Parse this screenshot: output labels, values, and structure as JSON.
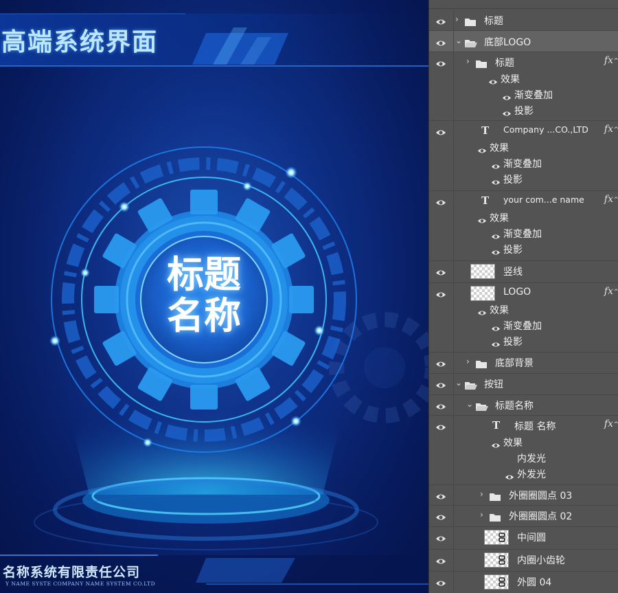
{
  "canvas": {
    "header_title": "高端系统界面",
    "gear_title_line1": "标题",
    "gear_title_line2": "名称",
    "company_name": "名称系统有限责任公司",
    "company_english": "Y NAME SYSTE COMPANY NAME SYSTEM CO.LTD"
  },
  "layers_panel": {
    "top_strip_text": "",
    "rows": [
      {
        "id": "r1",
        "type": "group",
        "label": "标题",
        "expanded": false,
        "fx": false
      },
      {
        "id": "r2",
        "type": "group",
        "label": "底部LOGO",
        "expanded": true,
        "fx": false,
        "selected": true
      },
      {
        "id": "r3",
        "type": "group",
        "label": "标题",
        "expanded": false,
        "fx": true,
        "effects_label": "效果",
        "effects": [
          "渐变叠加",
          "投影"
        ]
      },
      {
        "id": "r4",
        "type": "text",
        "label": "Company ...CO.,LTD",
        "fx": true,
        "effects_label": "效果",
        "effects": [
          "渐变叠加",
          "投影"
        ]
      },
      {
        "id": "r5",
        "type": "text",
        "label": "your com...e  name",
        "fx": true,
        "effects_label": "效果",
        "effects": [
          "渐变叠加",
          "投影"
        ]
      },
      {
        "id": "r6",
        "type": "pixel",
        "label": "竖线",
        "fx": false
      },
      {
        "id": "r7",
        "type": "pixel",
        "label": "LOGO",
        "fx": true,
        "effects_label": "效果",
        "effects": [
          "渐变叠加",
          "投影"
        ]
      },
      {
        "id": "r8",
        "type": "group",
        "label": "底部背景",
        "expanded": false,
        "fx": false
      },
      {
        "id": "r9",
        "type": "group",
        "label": "按钮",
        "expanded": true,
        "fx": false
      },
      {
        "id": "r10",
        "type": "group",
        "label": "标题名称",
        "expanded": true,
        "fx": false
      },
      {
        "id": "r11",
        "type": "text",
        "label": "标题 名称",
        "fx": true,
        "effects_label": "效果",
        "effects": [
          "内发光",
          "外发光"
        ]
      },
      {
        "id": "r12",
        "type": "group",
        "label": "外圈圈圆点 03",
        "expanded": false,
        "fx": false
      },
      {
        "id": "r13",
        "type": "group",
        "label": "外圈圈圆点 02",
        "expanded": false,
        "fx": false
      },
      {
        "id": "r14",
        "type": "pixel-linked",
        "label": "中间圆",
        "fx": false
      },
      {
        "id": "r15",
        "type": "pixel-linked",
        "label": "内圈小齿轮",
        "fx": false
      },
      {
        "id": "r16",
        "type": "pixel-linked",
        "label": "外圆 04",
        "fx": false
      }
    ],
    "fx_label": "fx",
    "icons": {
      "eye": "eye-icon",
      "folder": "folder-icon",
      "text_layer": "text-layer-icon",
      "expand": "chevron-right-icon",
      "collapse": "chevron-down-icon",
      "link": "link-icon"
    }
  },
  "colors": {
    "accent_glow": "#3fb8ff",
    "panel_bg": "#535353",
    "panel_selected": "#636363"
  }
}
